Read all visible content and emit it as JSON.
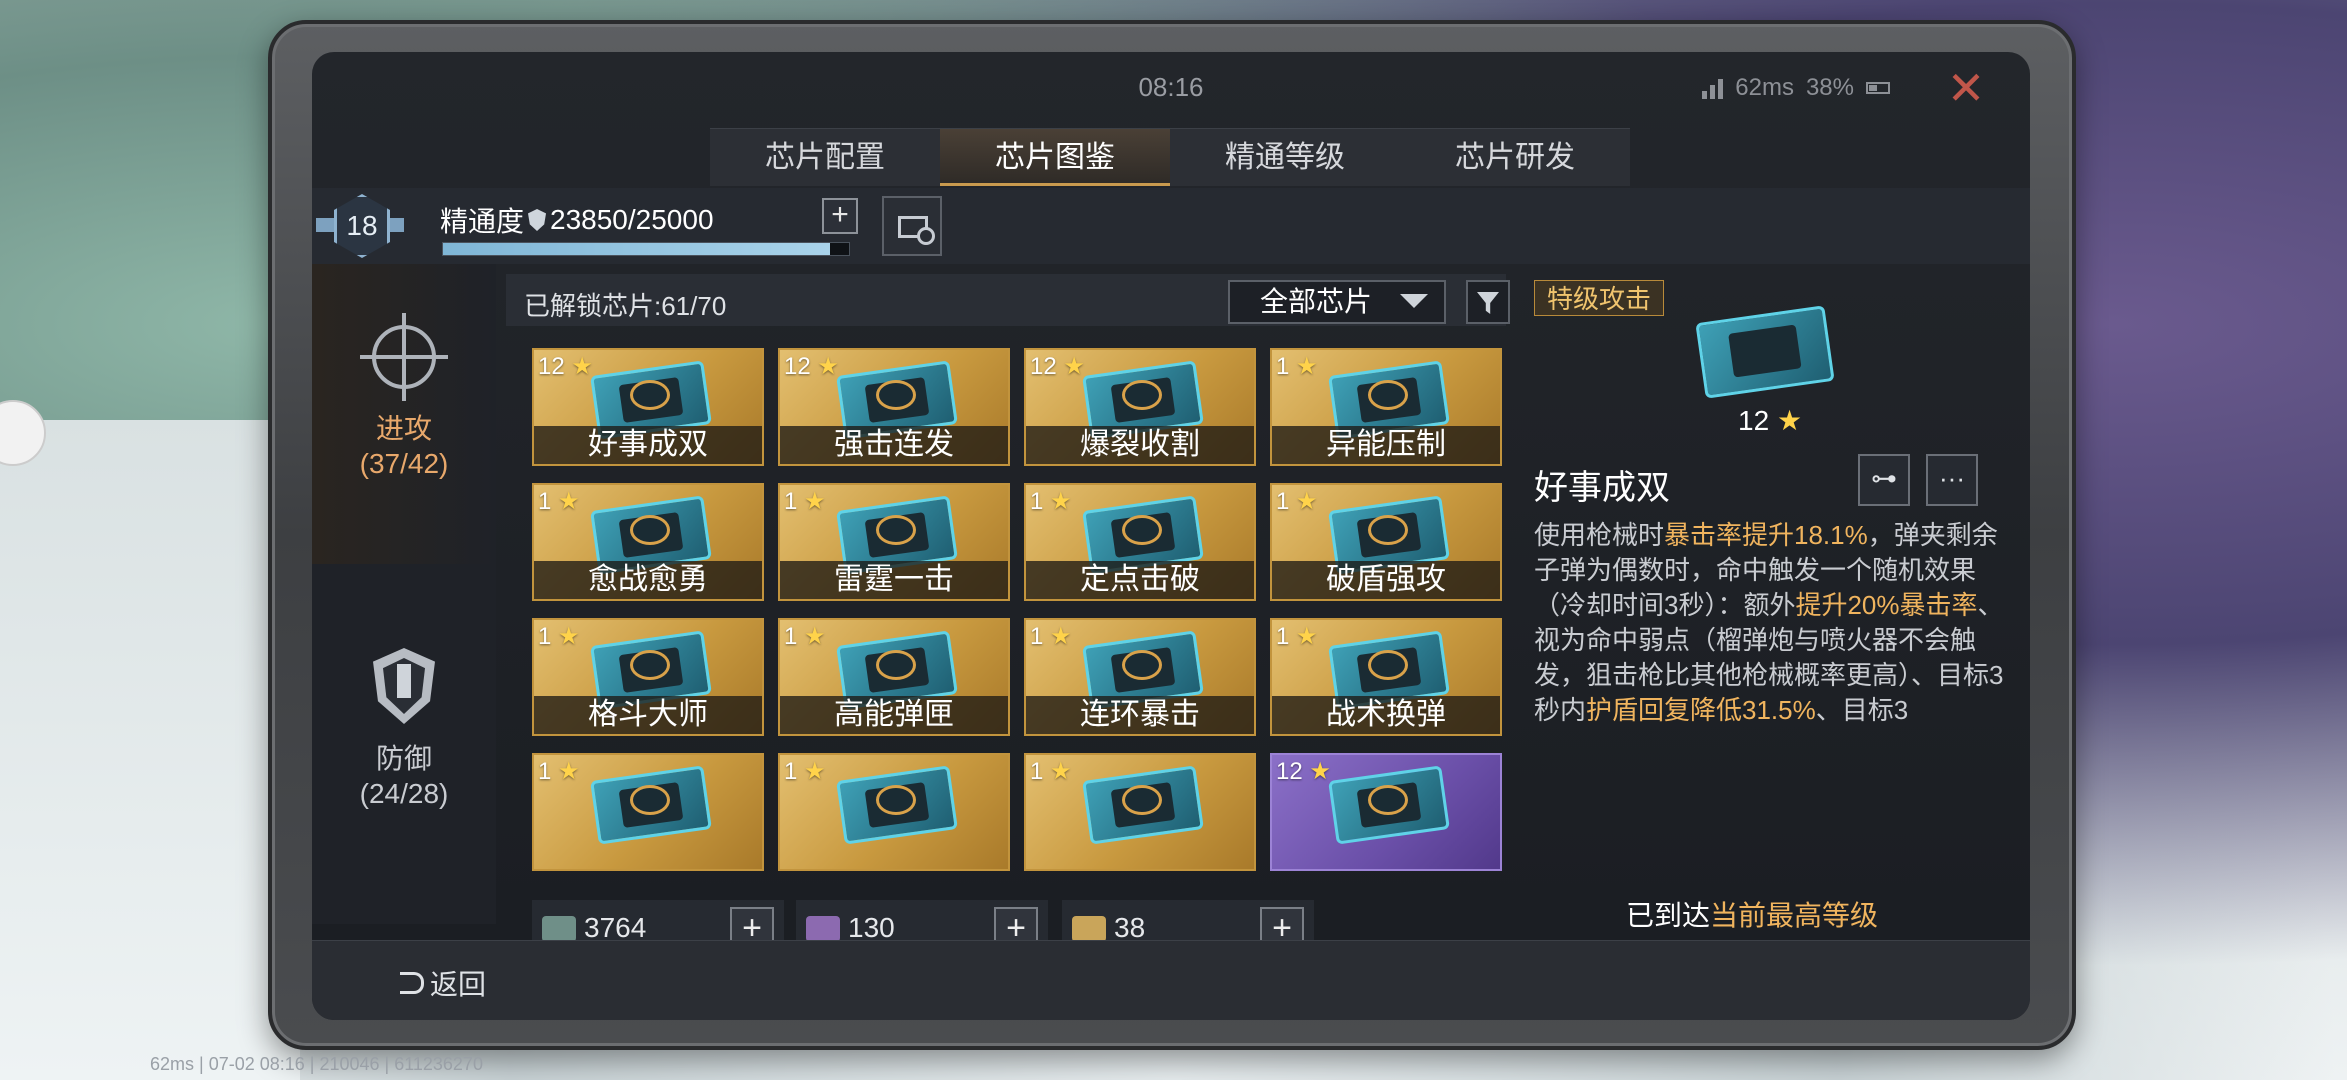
{
  "status": {
    "clock": "08:16",
    "ping": "62ms",
    "battery": "38%"
  },
  "tabs": [
    {
      "label": "芯片配置"
    },
    {
      "label": "芯片图鉴"
    },
    {
      "label": "精通等级"
    },
    {
      "label": "芯片研发"
    }
  ],
  "mastery": {
    "level": "18",
    "label": "精通度",
    "value": "23850/25000",
    "progress": 0.954
  },
  "nav": {
    "attack": {
      "label": "进攻",
      "count": "(37/42)"
    },
    "defense": {
      "label": "防御",
      "count": "(24/28)"
    }
  },
  "unlock": {
    "text": "已解锁芯片:61/70",
    "filter": "全部芯片"
  },
  "cards": [
    {
      "level": "12",
      "name": "好事成双"
    },
    {
      "level": "12",
      "name": "强击连发"
    },
    {
      "level": "12",
      "name": "爆裂收割"
    },
    {
      "level": "1",
      "name": "异能压制"
    },
    {
      "level": "1",
      "name": "愈战愈勇"
    },
    {
      "level": "1",
      "name": "雷霆一击"
    },
    {
      "level": "1",
      "name": "定点击破"
    },
    {
      "level": "1",
      "name": "破盾强攻"
    },
    {
      "level": "1",
      "name": "格斗大师"
    },
    {
      "level": "1",
      "name": "高能弹匣"
    },
    {
      "level": "1",
      "name": "连环暴击"
    },
    {
      "level": "1",
      "name": "战术换弹"
    },
    {
      "level": "1",
      "name": ""
    },
    {
      "level": "1",
      "name": ""
    },
    {
      "level": "1",
      "name": ""
    },
    {
      "level": "12",
      "name": ""
    }
  ],
  "currencies": [
    {
      "amount": "3764",
      "color": "#6f8f88"
    },
    {
      "amount": "130",
      "color": "#8c6ab0"
    },
    {
      "amount": "38",
      "color": "#c9a55a"
    }
  ],
  "detail": {
    "tag": "特级攻击",
    "level": "12",
    "name": "好事成双",
    "desc_parts": [
      {
        "t": "使用枪械时",
        "h": false
      },
      {
        "t": "暴击率提升18.1%",
        "h": true
      },
      {
        "t": "，弹夹剩余子弹为偶数时，命中触发一个随机效果（冷却时间3秒）：额外",
        "h": false
      },
      {
        "t": "提升20%暴击率",
        "h": true
      },
      {
        "t": "、视为命中弱点（榴弹炮与喷火器不会触发，狙击枪比其他枪械概率更高）、目标3秒内",
        "h": false
      },
      {
        "t": "护盾回复降低31.5%",
        "h": true
      },
      {
        "t": "、目标3",
        "h": false
      }
    ],
    "max_prefix": "已到达",
    "max_hl": "当前最高等级"
  },
  "back_label": "返回",
  "debug_text": "62ms | 07-02 08:16 | 210046 | 611236270"
}
